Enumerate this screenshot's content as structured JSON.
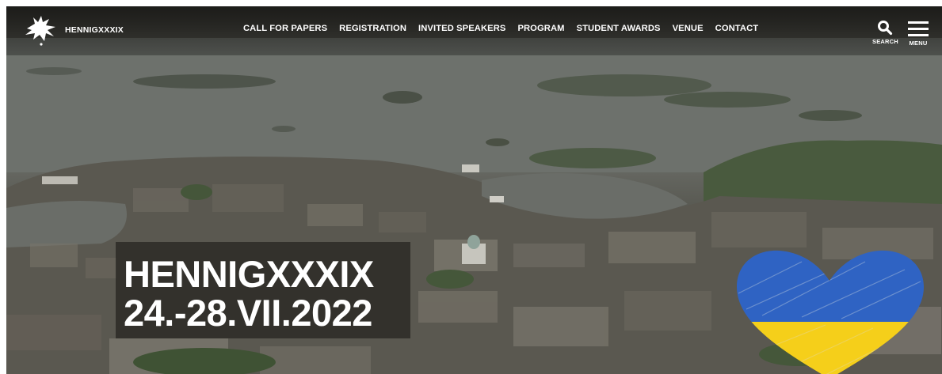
{
  "brand": {
    "name": "HENNIGXXXIX",
    "logo_icon": "sparrow-logo-icon"
  },
  "nav": {
    "items": [
      {
        "label": "CALL FOR PAPERS"
      },
      {
        "label": "REGISTRATION"
      },
      {
        "label": "INVITED SPEAKERS"
      },
      {
        "label": "PROGRAM"
      },
      {
        "label": "STUDENT AWARDS"
      },
      {
        "label": "VENUE"
      },
      {
        "label": "CONTACT"
      }
    ]
  },
  "tools": {
    "search_label": "SEARCH",
    "menu_label": "MENU"
  },
  "hero": {
    "title": "HENNIGXXXIX",
    "dates": "24.-28.VII.2022",
    "heart_colors": {
      "top": "#2f63c3",
      "bottom": "#f5cf1a"
    }
  }
}
